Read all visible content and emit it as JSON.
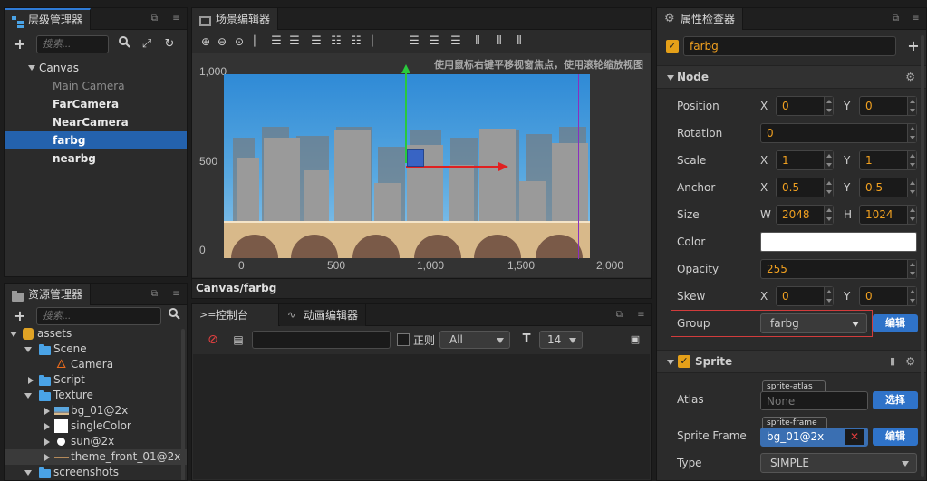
{
  "hierarchy": {
    "title": "层级管理器",
    "search_placeholder": "搜索...",
    "root": "Canvas",
    "children": [
      "Main Camera",
      "FarCamera",
      "NearCamera",
      "farbg",
      "nearbg"
    ],
    "selected": "farbg"
  },
  "assets": {
    "title": "资源管理器",
    "search_placeholder": "搜索...",
    "items": [
      {
        "label": "assets",
        "indent": 0
      },
      {
        "label": "Scene",
        "indent": 1
      },
      {
        "label": "Camera",
        "indent": 2
      },
      {
        "label": "Script",
        "indent": 1
      },
      {
        "label": "Texture",
        "indent": 1
      },
      {
        "label": "bg_01@2x",
        "indent": 2
      },
      {
        "label": "singleColor",
        "indent": 2
      },
      {
        "label": "sun@2x",
        "indent": 2
      },
      {
        "label": "theme_front_01@2x",
        "indent": 2
      },
      {
        "label": "screenshots",
        "indent": 1
      }
    ]
  },
  "scene": {
    "title": "场景编辑器",
    "hint": "使用鼠标右键平移视窗焦点，使用滚轮缩放视图",
    "breadcrumb": "Canvas/farbg",
    "y_ticks": [
      "1,000",
      "500",
      "0"
    ],
    "x_ticks": [
      "0",
      "500",
      "1,000",
      "1,500",
      "2,000"
    ]
  },
  "console": {
    "tab_console": "控制台",
    "tab_animation": "动画编辑器",
    "regex_label": "正则",
    "filter_value": "All",
    "font_size": "14"
  },
  "inspector": {
    "title": "属性检查器",
    "node_name": "farbg",
    "node_section": "Node",
    "position": {
      "label": "Position",
      "x": "0",
      "y": "0"
    },
    "rotation": {
      "label": "Rotation",
      "value": "0"
    },
    "scale": {
      "label": "Scale",
      "x": "1",
      "y": "1"
    },
    "anchor": {
      "label": "Anchor",
      "x": "0.5",
      "y": "0.5"
    },
    "size": {
      "label": "Size",
      "w": "2048",
      "h": "1024"
    },
    "color": {
      "label": "Color",
      "value": "#ffffff"
    },
    "opacity": {
      "label": "Opacity",
      "value": "255"
    },
    "skew": {
      "label": "Skew",
      "x": "0",
      "y": "0"
    },
    "group": {
      "label": "Group",
      "value": "farbg",
      "edit": "编辑"
    },
    "sprite_section": "Sprite",
    "atlas": {
      "label": "Atlas",
      "tag": "sprite-atlas",
      "value": "None",
      "button": "选择"
    },
    "sprite_frame": {
      "label": "Sprite Frame",
      "tag": "sprite-frame",
      "value": "bg_01@2x",
      "button": "编辑"
    },
    "type": {
      "label": "Type",
      "value": "SIMPLE"
    },
    "x_axis": "X",
    "y_axis": "Y",
    "w_axis": "W",
    "h_axis": "H"
  },
  "colors": {
    "accent": "#2462ad",
    "orange": "#f0a020",
    "sky": "#5aa6de",
    "ground": "#d8b98a"
  }
}
